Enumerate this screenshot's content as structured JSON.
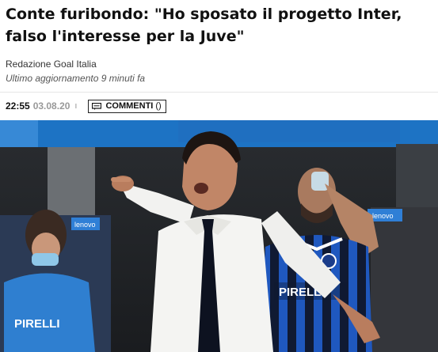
{
  "article": {
    "headline": "Conte furibondo: \"Ho sposato il progetto Inter, falso l'interesse per la Juve\"",
    "author": "Redazione Goal Italia",
    "updated": "Ultimo aggiornamento 9 minuti fa",
    "time": "22:55",
    "date": "03.08.20",
    "comments_label": "COMMENTI",
    "comments_count": "()"
  },
  "photo": {
    "jersey_sponsor": "PIRELLI",
    "board_text": "lenovo"
  },
  "colors": {
    "inter_blue": "#1f5fc9",
    "stadium_blue": "#1e74c6",
    "shirt_white": "#f4f4f2"
  }
}
